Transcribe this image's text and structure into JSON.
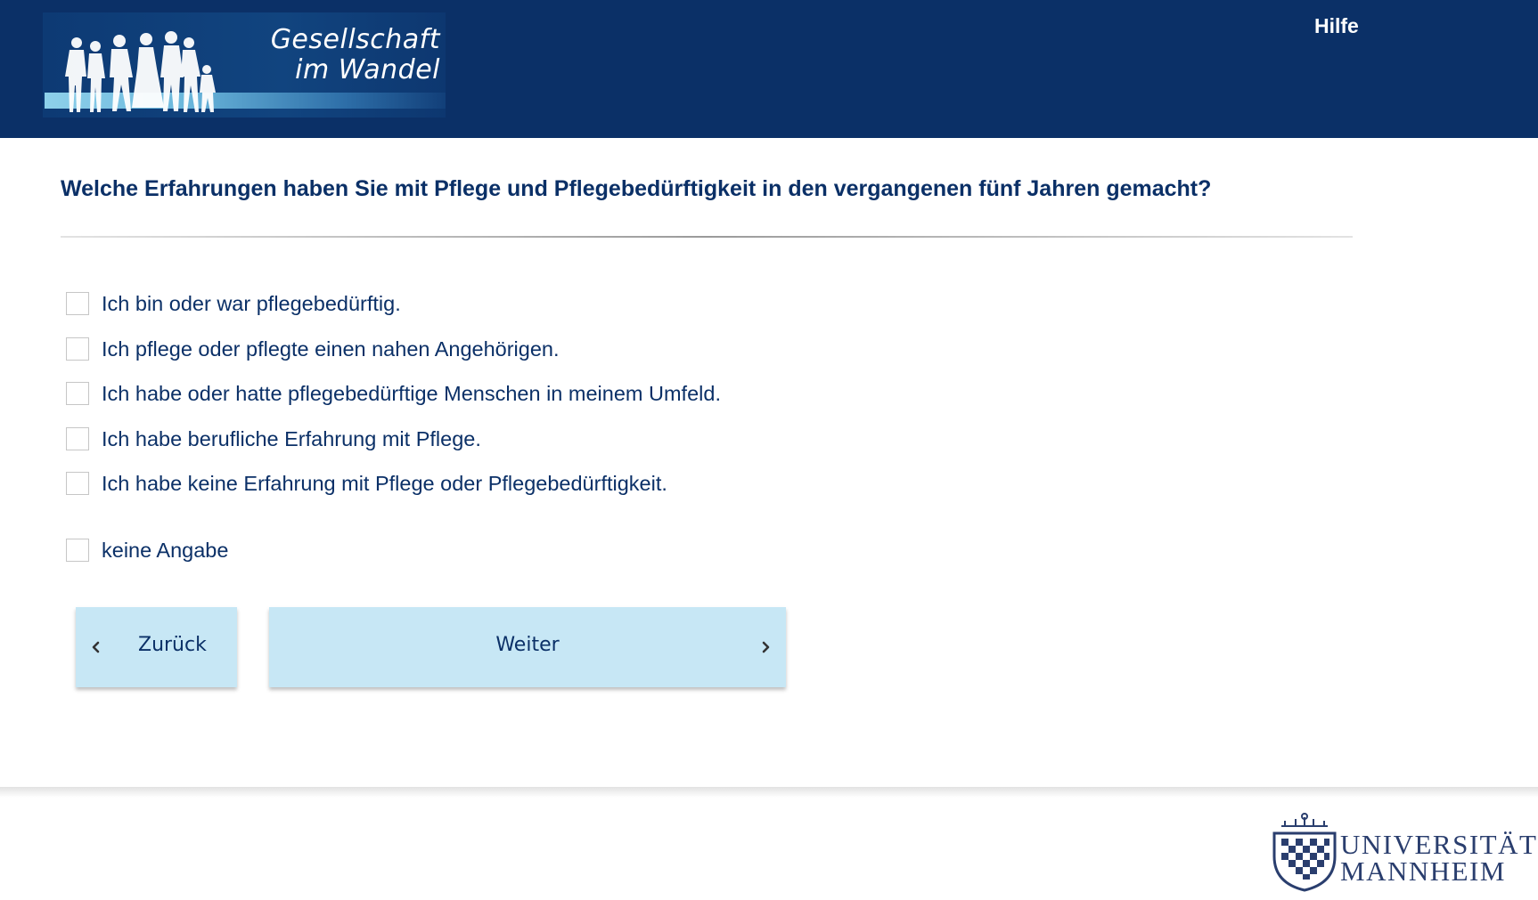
{
  "header": {
    "logo_line1": "Gesellschaft",
    "logo_line2": "im Wandel",
    "help_label": "Hilfe"
  },
  "question": {
    "text": "Welche Erfahrungen haben Sie mit Pflege und Pflegebedürftigkeit in den vergangenen fünf Jahren gemacht?"
  },
  "options": [
    {
      "label": "Ich bin oder war pflegebedürftig.",
      "checked": false
    },
    {
      "label": "Ich pflege oder pflegte einen nahen Angehörigen.",
      "checked": false
    },
    {
      "label": "Ich habe oder hatte pflegebedürftige Menschen in meinem Umfeld.",
      "checked": false
    },
    {
      "label": "Ich habe berufliche Erfahrung mit Pflege.",
      "checked": false
    },
    {
      "label": "Ich habe keine Erfahrung mit Pflege oder Pflegebedürftigkeit.",
      "checked": false
    },
    {
      "label": "keine Angabe",
      "checked": false
    }
  ],
  "navigation": {
    "back_label": "Zurück",
    "next_label": "Weiter"
  },
  "footer": {
    "university_line1": "UNIVERSITÄT",
    "university_line2": "MANNHEIM"
  },
  "colors": {
    "header_bg": "#0b3067",
    "text_primary": "#0b3067",
    "button_bg": "#c7e7f5",
    "logo_stripe": "#8ed0ea"
  },
  "icons": {
    "back": "chevron-left-icon",
    "next": "chevron-right-icon"
  }
}
